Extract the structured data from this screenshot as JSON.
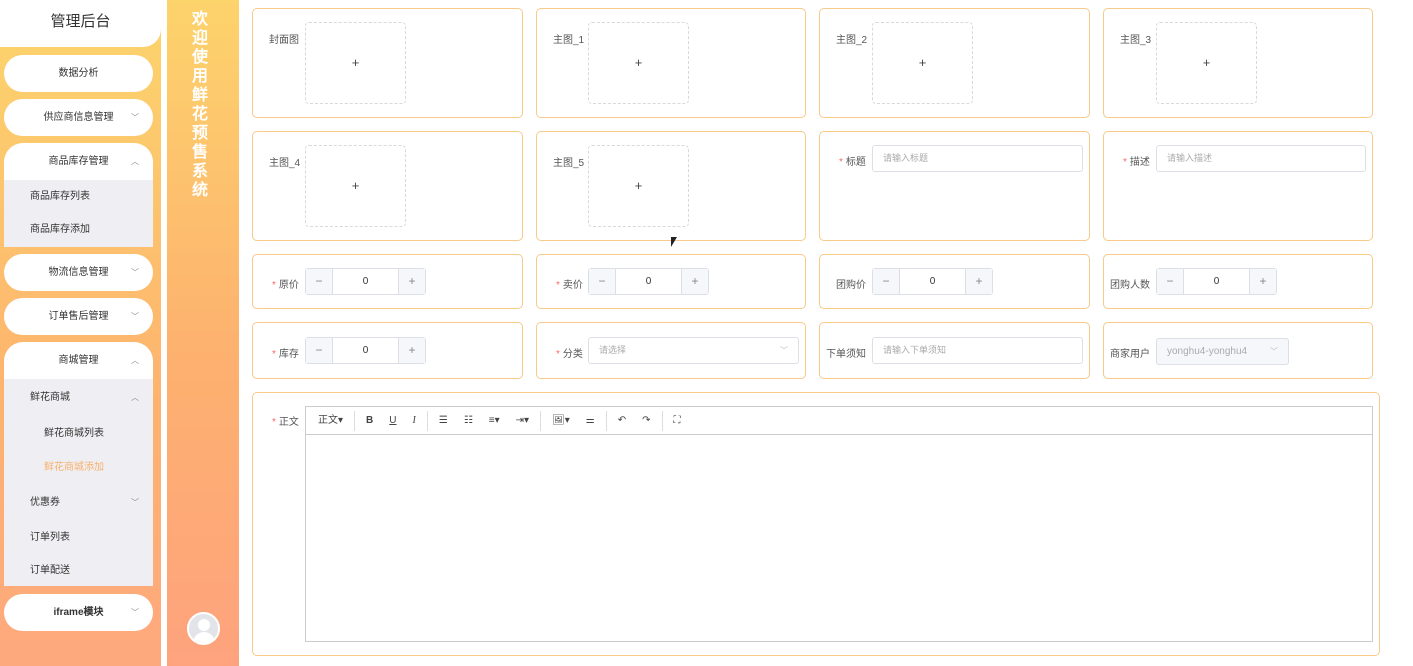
{
  "sidebar": {
    "title": "管理后台",
    "items": [
      {
        "label": "数据分析"
      },
      {
        "label": "供应商信息管理"
      },
      {
        "label": "商品库存管理",
        "sub": [
          "商品库存列表",
          "商品库存添加"
        ]
      },
      {
        "label": "物流信息管理"
      },
      {
        "label": "订单售后管理"
      },
      {
        "label": "商城管理",
        "sub": [
          "鲜花商城",
          "鲜花商城列表",
          "鲜花商城添加",
          "优惠券",
          "订单列表",
          "订单配送"
        ]
      },
      {
        "label": "iframe模块"
      }
    ]
  },
  "banner": {
    "text": "欢迎使用鲜花预售系统"
  },
  "form": {
    "cover": "封面图",
    "main1": "主图_1",
    "main2": "主图_2",
    "main3": "主图_3",
    "main4": "主图_4",
    "main5": "主图_5",
    "upload_plus": "+",
    "title_label": "标题",
    "title_placeholder": "请输入标题",
    "desc_label": "描述",
    "desc_placeholder": "请输入描述",
    "orig_price_label": "原价",
    "sale_price_label": "卖价",
    "group_price_label": "团购价",
    "group_count_label": "团购人数",
    "stock_label": "库存",
    "category_label": "分类",
    "category_placeholder": "请选择",
    "notice_label": "下单须知",
    "notice_placeholder": "请输入下单须知",
    "merchant_label": "商家用户",
    "merchant_value": "yonghu4-yonghu4",
    "content_label": "正文",
    "orig_price": "0",
    "sale_price": "0",
    "group_price": "0",
    "group_count": "0",
    "stock": "0",
    "required_mark": "*"
  },
  "editor": {
    "toolbar": [
      "正文▾",
      "B",
      "U",
      "I",
      "☰",
      "☷",
      "≡▾",
      "⇥▾",
      "🖼▾",
      "⚌",
      "↶",
      "↷",
      "⛶"
    ]
  }
}
